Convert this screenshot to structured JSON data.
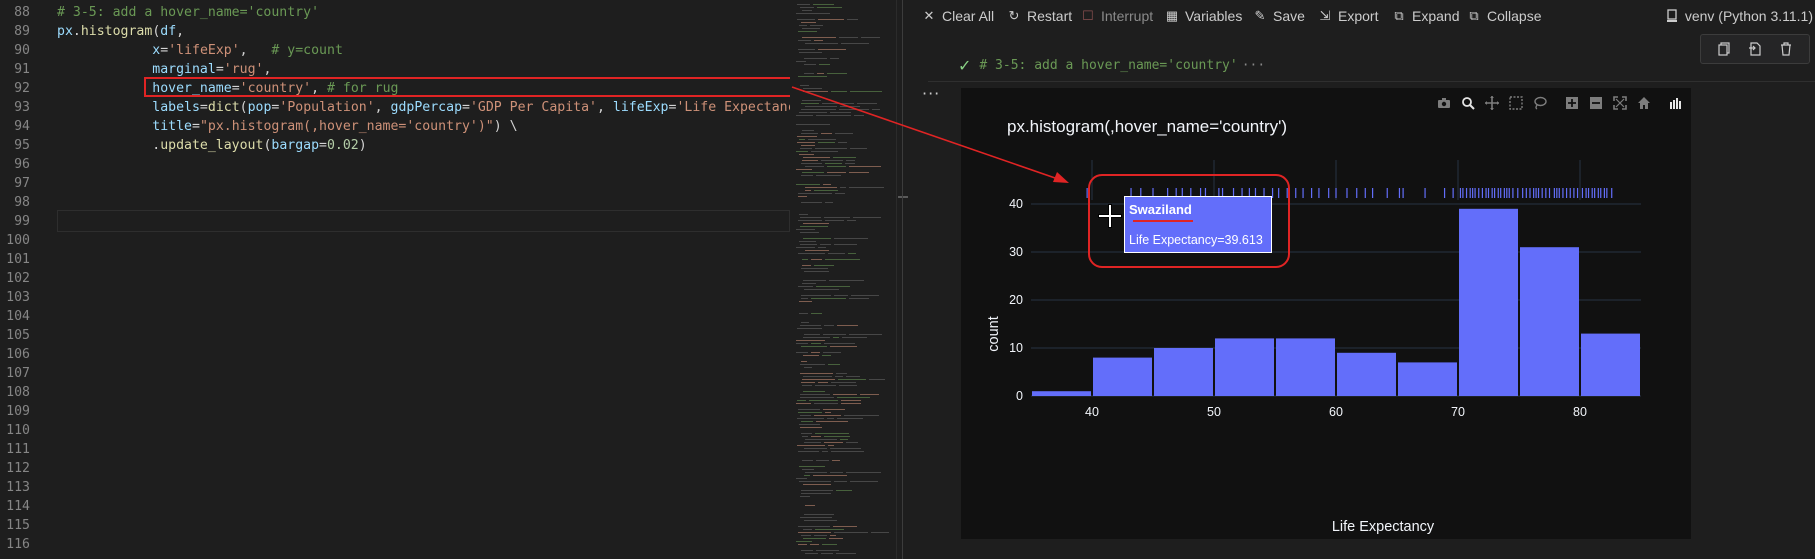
{
  "editor": {
    "lines": [
      {
        "num": "88",
        "tokens": [
          [
            "com",
            "# 3-5: add a hover_name='country'"
          ]
        ]
      },
      {
        "num": "89",
        "tokens": [
          [
            "var",
            "px"
          ],
          [
            "txt",
            "."
          ],
          [
            "fn",
            "histogram"
          ],
          [
            "txt",
            "("
          ],
          [
            "var",
            "df"
          ],
          [
            "txt",
            ","
          ]
        ]
      },
      {
        "num": "90",
        "tokens": [
          [
            "txt",
            "            "
          ],
          [
            "var",
            "x"
          ],
          [
            "txt",
            "="
          ],
          [
            "str",
            "'lifeExp'"
          ],
          [
            "txt",
            ",   "
          ],
          [
            "com",
            "# y=count"
          ]
        ]
      },
      {
        "num": "91",
        "tokens": [
          [
            "txt",
            "            "
          ],
          [
            "var",
            "marginal"
          ],
          [
            "txt",
            "="
          ],
          [
            "str",
            "'rug'"
          ],
          [
            "txt",
            ","
          ]
        ]
      },
      {
        "num": "92",
        "tokens": [
          [
            "txt",
            "            "
          ],
          [
            "var",
            "hover_name"
          ],
          [
            "txt",
            "="
          ],
          [
            "str",
            "'country'"
          ],
          [
            "txt",
            ", "
          ],
          [
            "com",
            "# for rug"
          ]
        ]
      },
      {
        "num": "93",
        "tokens": [
          [
            "txt",
            "            "
          ],
          [
            "var",
            "labels"
          ],
          [
            "txt",
            "="
          ],
          [
            "fn",
            "dict"
          ],
          [
            "txt",
            "("
          ],
          [
            "var",
            "pop"
          ],
          [
            "txt",
            "="
          ],
          [
            "str",
            "'Population'"
          ],
          [
            "txt",
            ", "
          ],
          [
            "var",
            "gdpPercap"
          ],
          [
            "txt",
            "="
          ],
          [
            "str",
            "'GDP Per Capita'"
          ],
          [
            "txt",
            ", "
          ],
          [
            "var",
            "lifeExp"
          ],
          [
            "txt",
            "="
          ],
          [
            "str",
            "'Life Expectancy'"
          ]
        ]
      },
      {
        "num": "94",
        "tokens": [
          [
            "txt",
            "            "
          ],
          [
            "var",
            "title"
          ],
          [
            "txt",
            "="
          ],
          [
            "str",
            "\"px.histogram(,hover_name='country')\""
          ],
          [
            "txt",
            ") \\"
          ]
        ]
      },
      {
        "num": "95",
        "tokens": [
          [
            "txt",
            "            ."
          ],
          [
            "fn",
            "update_layout"
          ],
          [
            "txt",
            "("
          ],
          [
            "var",
            "bargap"
          ],
          [
            "txt",
            "="
          ],
          [
            "num",
            "0.02"
          ],
          [
            "txt",
            ")"
          ]
        ]
      },
      {
        "num": "96",
        "tokens": []
      },
      {
        "num": "97",
        "tokens": []
      },
      {
        "num": "98",
        "tokens": []
      },
      {
        "num": "99",
        "tokens": []
      },
      {
        "num": "100",
        "tokens": []
      },
      {
        "num": "101",
        "tokens": []
      },
      {
        "num": "102",
        "tokens": []
      },
      {
        "num": "103",
        "tokens": []
      },
      {
        "num": "104",
        "tokens": []
      },
      {
        "num": "105",
        "tokens": []
      },
      {
        "num": "106",
        "tokens": []
      },
      {
        "num": "107",
        "tokens": []
      },
      {
        "num": "108",
        "tokens": []
      },
      {
        "num": "109",
        "tokens": []
      },
      {
        "num": "110",
        "tokens": []
      },
      {
        "num": "111",
        "tokens": []
      },
      {
        "num": "112",
        "tokens": []
      },
      {
        "num": "113",
        "tokens": []
      },
      {
        "num": "114",
        "tokens": []
      },
      {
        "num": "115",
        "tokens": []
      },
      {
        "num": "116",
        "tokens": []
      }
    ]
  },
  "toolbar": {
    "items": [
      {
        "label": "Clear All",
        "icon": "close-icon",
        "glyph": "✕",
        "enabled": true
      },
      {
        "label": "Restart",
        "icon": "restart-icon",
        "glyph": "↻",
        "enabled": true
      },
      {
        "label": "Interrupt",
        "icon": "interrupt-icon",
        "glyph": "☐",
        "enabled": false
      },
      {
        "label": "Variables",
        "icon": "variables-icon",
        "glyph": "▦",
        "enabled": true
      },
      {
        "label": "Save",
        "icon": "save-icon",
        "glyph": "✎",
        "enabled": true
      },
      {
        "label": "Export",
        "icon": "export-icon",
        "glyph": "⇲",
        "enabled": true
      },
      {
        "label": "Expand",
        "icon": "expand-icon",
        "glyph": "⧉",
        "enabled": true
      },
      {
        "label": "Collapse",
        "icon": "collapse-icon",
        "glyph": "⧉",
        "enabled": true
      }
    ],
    "kernel_label": "venv (Python 3.11.1)"
  },
  "cell": {
    "summary": "# 3-5: add a hover_name='country'",
    "summary_more": "···",
    "more_actions": "···"
  },
  "tooltip": {
    "name": "Swaziland",
    "value_text": "Life Expectancy=39.613"
  },
  "colors": {
    "bar": "#636efa",
    "plot_bg": "#111111",
    "grid": "#283442",
    "annotation": "#e02424"
  },
  "chart_data": {
    "type": "bar",
    "title": "px.histogram(,hover_name='country')",
    "xlabel": "Life Expectancy",
    "ylabel": "count",
    "bins": [
      {
        "x0": 35,
        "x1": 40,
        "count": 1
      },
      {
        "x0": 40,
        "x1": 45,
        "count": 8
      },
      {
        "x0": 45,
        "x1": 50,
        "count": 10
      },
      {
        "x0": 50,
        "x1": 55,
        "count": 12
      },
      {
        "x0": 55,
        "x1": 60,
        "count": 12
      },
      {
        "x0": 60,
        "x1": 65,
        "count": 9
      },
      {
        "x0": 65,
        "x1": 70,
        "count": 7
      },
      {
        "x0": 70,
        "x1": 75,
        "count": 39
      },
      {
        "x0": 75,
        "x1": 80,
        "count": 31
      },
      {
        "x0": 80,
        "x1": 85,
        "count": 13
      }
    ],
    "xlim": [
      35,
      85
    ],
    "ylim": [
      0,
      45
    ],
    "xticks": [
      40,
      50,
      60,
      70,
      80
    ],
    "yticks": [
      0,
      10,
      20,
      30,
      40
    ],
    "rug": [
      39.6,
      43.2,
      44.0,
      45.0,
      46.2,
      46.9,
      47.4,
      48.1,
      48.9,
      49.3,
      50.4,
      50.7,
      51.6,
      52.3,
      52.9,
      53.4,
      54.1,
      54.8,
      55.3,
      56.0,
      56.7,
      57.3,
      58.0,
      58.6,
      59.4,
      60.0,
      60.9,
      61.7,
      62.4,
      63.0,
      64.2,
      65.2,
      65.5,
      67.3,
      68.9,
      69.6,
      70.2,
      70.4,
      70.7,
      71.0,
      71.2,
      71.4,
      71.7,
      72.0,
      72.3,
      72.5,
      72.8,
      73.0,
      73.3,
      73.5,
      73.8,
      74.0,
      74.2,
      74.5,
      74.9,
      75.3,
      75.6,
      75.9,
      76.2,
      76.4,
      76.6,
      76.9,
      77.2,
      77.5,
      77.9,
      78.1,
      78.3,
      78.6,
      78.9,
      79.2,
      79.5,
      79.8,
      80.2,
      80.5,
      80.7,
      81.0,
      81.2,
      81.5,
      81.7,
      82.0,
      82.2,
      82.6
    ],
    "grid": true
  }
}
